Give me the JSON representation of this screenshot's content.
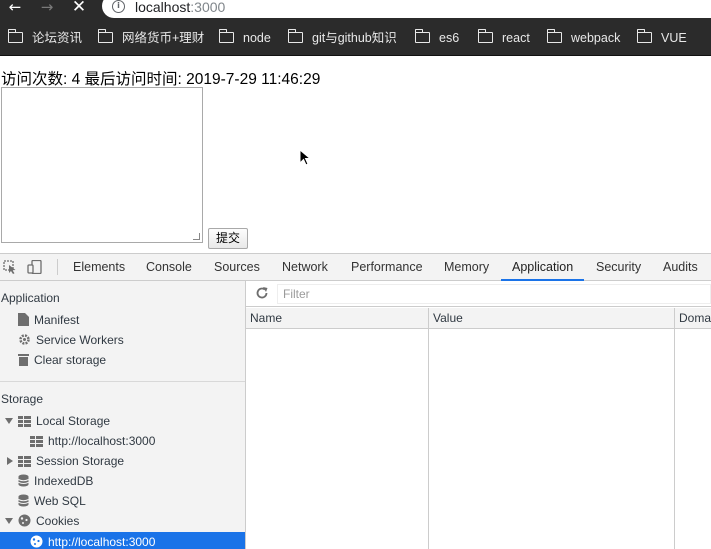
{
  "browser": {
    "url_host": "localhost",
    "url_port": ":3000",
    "icons": [
      "back-arrow-icon",
      "forward-arrow-icon",
      "close-icon",
      "info-icon"
    ]
  },
  "bookmarks": [
    {
      "label": "论坛资讯"
    },
    {
      "label": "网络货币+理财"
    },
    {
      "label": "node"
    },
    {
      "label": "git与github知识"
    },
    {
      "label": "es6"
    },
    {
      "label": "react"
    },
    {
      "label": "webpack"
    },
    {
      "label": "VUE"
    }
  ],
  "page": {
    "visit_line": "访问次数: 4 最后访问时间: 2019-7-29 11:46:29",
    "submit_label": "提交"
  },
  "devtools": {
    "tabs": [
      "Elements",
      "Console",
      "Sources",
      "Network",
      "Performance",
      "Memory",
      "Application",
      "Security",
      "Audits"
    ],
    "active_tab": "Application",
    "sidebar": {
      "application_header": "Application",
      "application_items": [
        "Manifest",
        "Service Workers",
        "Clear storage"
      ],
      "storage_header": "Storage",
      "storage_items": [
        "Local Storage",
        "http://localhost:3000",
        "Session Storage",
        "IndexedDB",
        "Web SQL",
        "Cookies",
        "http://localhost:3000"
      ]
    },
    "filter_placeholder": "Filter",
    "columns": [
      "Name",
      "Value",
      "Doma"
    ]
  },
  "colors": {
    "chrome_dark": "#2b2b2b",
    "devtools_panel": "#f3f3f3",
    "accent_blue": "#1a73e8"
  }
}
